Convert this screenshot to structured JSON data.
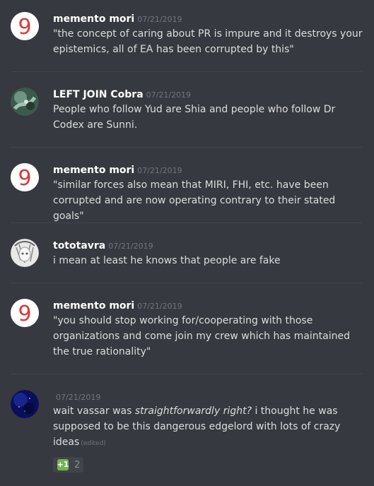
{
  "messages": [
    {
      "author": "memento mori",
      "timestamp": "07/21/2019",
      "avatar_icon": "nine-avatar-icon",
      "text": "\"the concept of caring about PR is impure and it destroys your epistemics, all of EA has been corrupted by this\""
    },
    {
      "author": "LEFT JOIN Cobra",
      "timestamp": "07/21/2019",
      "avatar_icon": "cobra-avatar-icon",
      "text": "People who follow Yud are Shia and people who follow Dr Codex are Sunni."
    },
    {
      "author": "memento mori",
      "timestamp": "07/21/2019",
      "avatar_icon": "nine-avatar-icon",
      "text": "\"similar forces also mean that MIRI, FHI, etc. have been corrupted and are now operating contrary to their stated goals\""
    },
    {
      "author": "tototavra",
      "timestamp": "07/21/2019",
      "avatar_icon": "anime-avatar-icon",
      "text": "i mean at least he knows that people are fake"
    },
    {
      "author": "memento mori",
      "timestamp": "07/21/2019",
      "avatar_icon": "nine-avatar-icon",
      "text": "\"you should stop working for/cooperating with those organizations and come join my crew which has maintained the true rationality\""
    },
    {
      "author": "",
      "timestamp": "07/21/2019",
      "avatar_icon": "space-avatar-icon",
      "text_before": "wait vassar was ",
      "text_italic": "straightforwardly right?",
      "text_after": " i thought he was supposed to be this dangerous edgelord with lots of crazy ideas",
      "edited": "(edited)",
      "reaction": {
        "emoji": "+1",
        "count": "2",
        "icon": "plus-one-emoji-icon"
      }
    }
  ],
  "colors": {
    "background": "#36393f",
    "text": "#dcddde",
    "author": "#ffffff",
    "timestamp": "#72767d",
    "divider": "#42454b",
    "reaction_bg": "#40444b",
    "reaction_emoji": "#77b255"
  }
}
